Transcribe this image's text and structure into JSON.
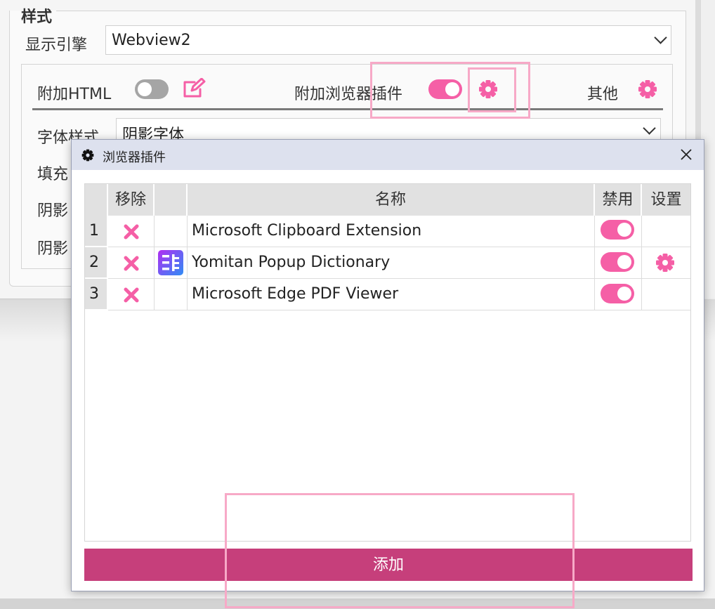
{
  "settings": {
    "group_title": "样式",
    "engine_label": "显示引擎",
    "engine_value": "Webview2",
    "tabs": {
      "append_html_label": "附加HTML",
      "append_html_enabled": false,
      "browser_plugins_label": "附加浏览器插件",
      "browser_plugins_enabled": true,
      "other_label": "其他"
    },
    "font_style_label": "字体样式",
    "font_style_value": "阴影字体",
    "fill_label": "填充",
    "shadow1_label": "阴影",
    "shadow2_label": "阴影"
  },
  "dialog": {
    "title": "浏览器插件",
    "table": {
      "headers": {
        "remove": "移除",
        "icon": "",
        "name": "名称",
        "disable": "禁用",
        "settings": "设置"
      },
      "rows": [
        {
          "index": "1",
          "name": "Microsoft Clipboard Extension",
          "enabled": true,
          "has_icon": false,
          "has_settings": false
        },
        {
          "index": "2",
          "name": "Yomitan Popup Dictionary",
          "enabled": true,
          "has_icon": true,
          "has_settings": true
        },
        {
          "index": "3",
          "name": "Microsoft Edge PDF Viewer",
          "enabled": true,
          "has_icon": false,
          "has_settings": false
        }
      ]
    },
    "add_label": "添加"
  },
  "colors": {
    "accent_pink": "#f55fa6",
    "add_button": "#c63f7b",
    "highlight_box": "#f7a9c7",
    "dialog_titlebar": "#dde1ee"
  }
}
